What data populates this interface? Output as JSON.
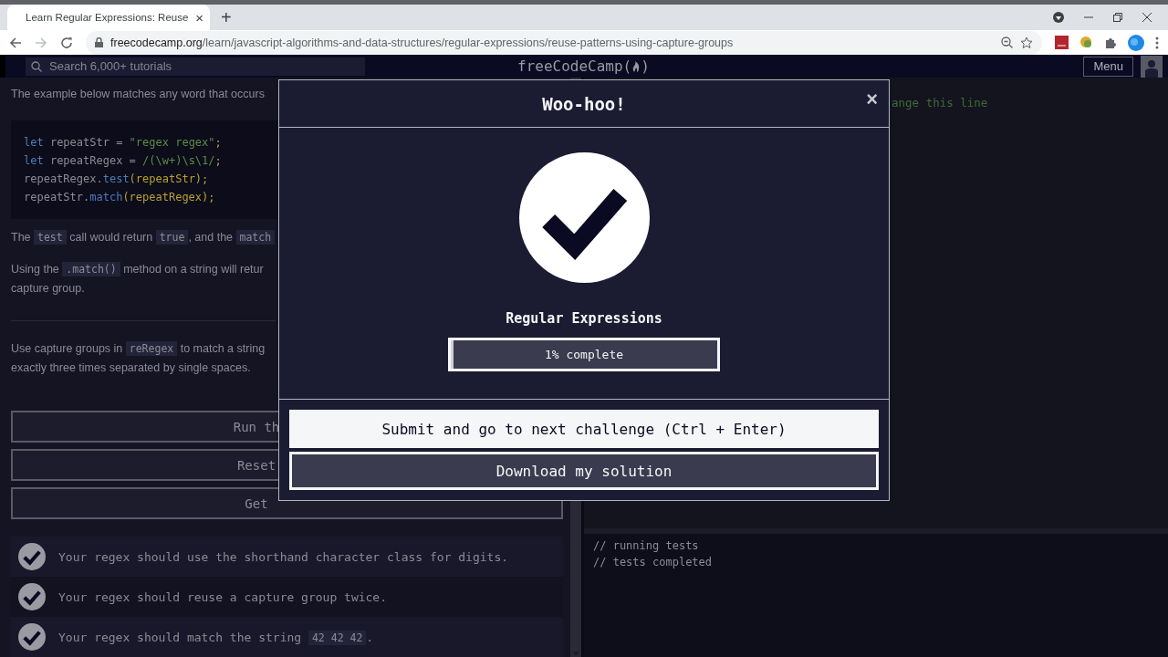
{
  "browser": {
    "tab": {
      "title": "Learn Regular Expressions: Reuse",
      "close": "×"
    },
    "new_tab": "+",
    "url_host": "freecodecamp.org",
    "url_path": "/learn/javascript-algorithms-and-data-structures/regular-expressions/reuse-patterns-using-capture-groups"
  },
  "header": {
    "search": {
      "placeholder": "Search 6,000+ tutorials"
    },
    "logo": {
      "before": "freeCodeCamp(",
      "after": ")"
    },
    "menu": "Menu"
  },
  "lesson": {
    "intro": [
      {
        "text": "The example below matches any word that occurs",
        "code": false
      }
    ],
    "code_lines": [
      [
        {
          "text": "let",
          "kind": "keyword"
        },
        {
          "text": " repeatStr = ",
          "kind": "plain"
        },
        {
          "text": "\"regex regex\"",
          "kind": "string"
        },
        {
          "text": ";",
          "kind": "punct"
        }
      ],
      [
        {
          "text": "let",
          "kind": "keyword"
        },
        {
          "text": " repeatRegex = ",
          "kind": "plain"
        },
        {
          "text": "/(\\w+)\\s\\1/",
          "kind": "string"
        },
        {
          "text": ";",
          "kind": "punct"
        }
      ],
      [
        {
          "text": "repeatRegex.",
          "kind": "plain"
        },
        {
          "text": "test",
          "kind": "method"
        },
        {
          "text": "(repeatStr)",
          "kind": "punct"
        },
        {
          "text": ";",
          "kind": "punct"
        }
      ],
      [
        {
          "text": "repeatStr.",
          "kind": "plain"
        },
        {
          "text": "match",
          "kind": "method"
        },
        {
          "text": "(repeatRegex)",
          "kind": "punct"
        },
        {
          "text": ";",
          "kind": "punct"
        }
      ]
    ],
    "paragraphs": [
      [
        {
          "text": "The ",
          "code": false
        },
        {
          "text": "test",
          "code": true
        },
        {
          "text": " call would return ",
          "code": false
        },
        {
          "text": "true",
          "code": true
        },
        {
          "text": ", and the ",
          "code": false
        },
        {
          "text": "match",
          "code": true
        }
      ],
      [
        {
          "text": "Using the ",
          "code": false
        },
        {
          "text": ".match()",
          "code": true
        },
        {
          "text": " method on a string will retur",
          "code": false
        }
      ],
      [
        {
          "text": "capture group.",
          "code": false
        }
      ]
    ],
    "instructions": [
      [
        {
          "text": "Use capture groups in ",
          "code": false
        },
        {
          "text": "reRegex",
          "code": true
        },
        {
          "text": " to match a string",
          "code": false
        }
      ],
      [
        {
          "text": "exactly three times separated by single spaces.",
          "code": false
        }
      ]
    ],
    "buttons": [
      "Run th",
      "Reset",
      "Get"
    ],
    "tests": [
      {
        "passed": true,
        "parts": [
          {
            "text": "Your regex should use the shorthand character class for digits.",
            "code": false
          }
        ]
      },
      {
        "passed": true,
        "parts": [
          {
            "text": "Your regex should reuse a capture group twice.",
            "code": false
          }
        ]
      },
      {
        "passed": true,
        "parts": [
          {
            "text": "Your regex should match the string ",
            "code": false
          },
          {
            "text": "42 42 42",
            "code": true
          },
          {
            "text": ".",
            "code": false
          }
        ]
      }
    ]
  },
  "editor": {
    "visible_line": "ange this line"
  },
  "console": {
    "lines": [
      "// running tests",
      "// tests completed"
    ]
  },
  "modal": {
    "title": "Woo-hoo!",
    "close": "×",
    "block": "Regular Expressions",
    "progress": {
      "level": 0.01,
      "label": "1% complete"
    },
    "buttons": [
      {
        "label": "Submit and go to next challenge (Ctrl + Enter)",
        "kind": "primary"
      },
      {
        "label": "Download my solution",
        "kind": "secondary"
      }
    ]
  }
}
